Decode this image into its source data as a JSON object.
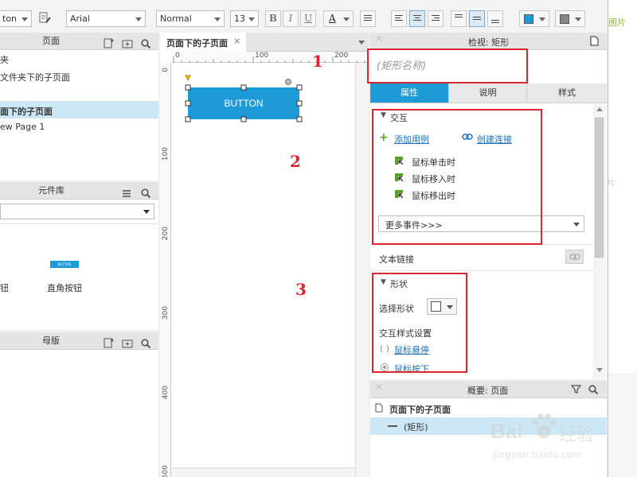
{
  "toolbar": {
    "font_select_partial": "ton",
    "font_family": "Arial",
    "font_weight": "Normal",
    "font_size": "13",
    "bold": "B",
    "italic": "I",
    "underline": "U",
    "font_color": "A"
  },
  "pages_panel": {
    "title": "页面",
    "items": [
      "夹",
      "文件夹下的子页面",
      "面下的子页面",
      "ew Page 1"
    ]
  },
  "library_panel": {
    "title": "元件库",
    "widget_label_left": "钮",
    "widget_label_right": "直角按钮",
    "widget_preview_text": "BUTTON"
  },
  "masters_panel": {
    "title": "母版"
  },
  "canvas": {
    "tab_title": "页面下的子页面",
    "tab_close": "×",
    "ruler_h": [
      "0",
      "100",
      "200"
    ],
    "ruler_v": [
      "0",
      "100",
      "200",
      "300",
      "400",
      "500"
    ],
    "button_text": "BUTTON"
  },
  "inspector": {
    "header": "检视: 矩形",
    "name_placeholder": "(矩形名称)",
    "tabs": [
      "属性",
      "说明",
      "样式"
    ],
    "interaction_title": "交互",
    "add_case": "添加用例",
    "create_link": "创建连接",
    "events": [
      "鼠标单击时",
      "鼠标移入时",
      "鼠标移出时"
    ],
    "more_events": "更多事件>>>",
    "text_link": "文本链接",
    "shape_title": "形状",
    "select_shape": "选择形状",
    "interaction_style": "交互样式设置",
    "mouse_hover": "鼠标悬停",
    "mouse_down": "鼠标按下"
  },
  "outline": {
    "header": "概要: 页面",
    "page": "页面下的子页面",
    "item": "(矩形)"
  },
  "annotations": [
    "1",
    "2",
    "3"
  ],
  "far_right": {
    "text_top": "图片",
    "text_mid": "片"
  },
  "watermark": {
    "brand": "Bai",
    "brand_cn": "经验",
    "url": "jingyan.baidu.com"
  },
  "colors": {
    "accent": "#1e9ad6",
    "annotation_red": "#d9262f",
    "link": "#1f6fb2"
  }
}
